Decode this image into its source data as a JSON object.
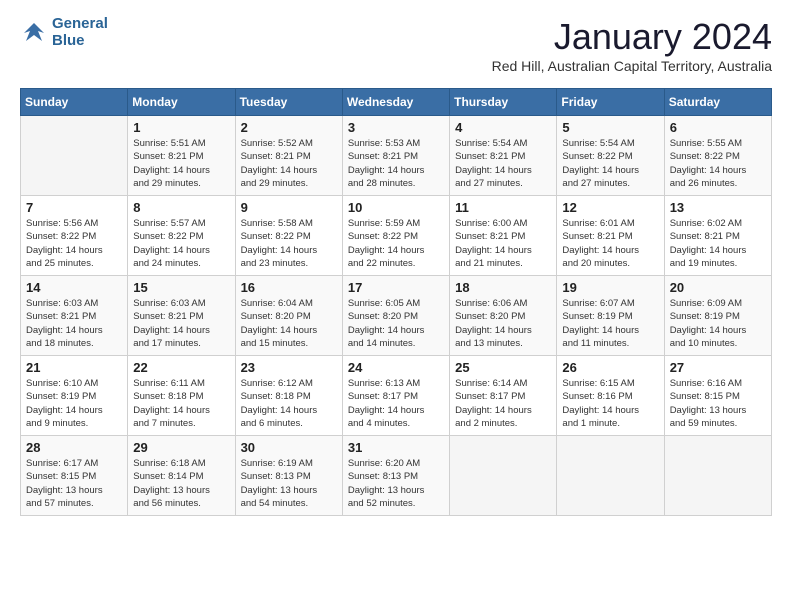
{
  "header": {
    "logo_line1": "General",
    "logo_line2": "Blue",
    "month": "January 2024",
    "subtitle": "Red Hill, Australian Capital Territory, Australia"
  },
  "weekdays": [
    "Sunday",
    "Monday",
    "Tuesday",
    "Wednesday",
    "Thursday",
    "Friday",
    "Saturday"
  ],
  "weeks": [
    [
      {
        "day": "",
        "info": ""
      },
      {
        "day": "1",
        "info": "Sunrise: 5:51 AM\nSunset: 8:21 PM\nDaylight: 14 hours\nand 29 minutes."
      },
      {
        "day": "2",
        "info": "Sunrise: 5:52 AM\nSunset: 8:21 PM\nDaylight: 14 hours\nand 29 minutes."
      },
      {
        "day": "3",
        "info": "Sunrise: 5:53 AM\nSunset: 8:21 PM\nDaylight: 14 hours\nand 28 minutes."
      },
      {
        "day": "4",
        "info": "Sunrise: 5:54 AM\nSunset: 8:21 PM\nDaylight: 14 hours\nand 27 minutes."
      },
      {
        "day": "5",
        "info": "Sunrise: 5:54 AM\nSunset: 8:22 PM\nDaylight: 14 hours\nand 27 minutes."
      },
      {
        "day": "6",
        "info": "Sunrise: 5:55 AM\nSunset: 8:22 PM\nDaylight: 14 hours\nand 26 minutes."
      }
    ],
    [
      {
        "day": "7",
        "info": "Sunrise: 5:56 AM\nSunset: 8:22 PM\nDaylight: 14 hours\nand 25 minutes."
      },
      {
        "day": "8",
        "info": "Sunrise: 5:57 AM\nSunset: 8:22 PM\nDaylight: 14 hours\nand 24 minutes."
      },
      {
        "day": "9",
        "info": "Sunrise: 5:58 AM\nSunset: 8:22 PM\nDaylight: 14 hours\nand 23 minutes."
      },
      {
        "day": "10",
        "info": "Sunrise: 5:59 AM\nSunset: 8:22 PM\nDaylight: 14 hours\nand 22 minutes."
      },
      {
        "day": "11",
        "info": "Sunrise: 6:00 AM\nSunset: 8:21 PM\nDaylight: 14 hours\nand 21 minutes."
      },
      {
        "day": "12",
        "info": "Sunrise: 6:01 AM\nSunset: 8:21 PM\nDaylight: 14 hours\nand 20 minutes."
      },
      {
        "day": "13",
        "info": "Sunrise: 6:02 AM\nSunset: 8:21 PM\nDaylight: 14 hours\nand 19 minutes."
      }
    ],
    [
      {
        "day": "14",
        "info": "Sunrise: 6:03 AM\nSunset: 8:21 PM\nDaylight: 14 hours\nand 18 minutes."
      },
      {
        "day": "15",
        "info": "Sunrise: 6:03 AM\nSunset: 8:21 PM\nDaylight: 14 hours\nand 17 minutes."
      },
      {
        "day": "16",
        "info": "Sunrise: 6:04 AM\nSunset: 8:20 PM\nDaylight: 14 hours\nand 15 minutes."
      },
      {
        "day": "17",
        "info": "Sunrise: 6:05 AM\nSunset: 8:20 PM\nDaylight: 14 hours\nand 14 minutes."
      },
      {
        "day": "18",
        "info": "Sunrise: 6:06 AM\nSunset: 8:20 PM\nDaylight: 14 hours\nand 13 minutes."
      },
      {
        "day": "19",
        "info": "Sunrise: 6:07 AM\nSunset: 8:19 PM\nDaylight: 14 hours\nand 11 minutes."
      },
      {
        "day": "20",
        "info": "Sunrise: 6:09 AM\nSunset: 8:19 PM\nDaylight: 14 hours\nand 10 minutes."
      }
    ],
    [
      {
        "day": "21",
        "info": "Sunrise: 6:10 AM\nSunset: 8:19 PM\nDaylight: 14 hours\nand 9 minutes."
      },
      {
        "day": "22",
        "info": "Sunrise: 6:11 AM\nSunset: 8:18 PM\nDaylight: 14 hours\nand 7 minutes."
      },
      {
        "day": "23",
        "info": "Sunrise: 6:12 AM\nSunset: 8:18 PM\nDaylight: 14 hours\nand 6 minutes."
      },
      {
        "day": "24",
        "info": "Sunrise: 6:13 AM\nSunset: 8:17 PM\nDaylight: 14 hours\nand 4 minutes."
      },
      {
        "day": "25",
        "info": "Sunrise: 6:14 AM\nSunset: 8:17 PM\nDaylight: 14 hours\nand 2 minutes."
      },
      {
        "day": "26",
        "info": "Sunrise: 6:15 AM\nSunset: 8:16 PM\nDaylight: 14 hours\nand 1 minute."
      },
      {
        "day": "27",
        "info": "Sunrise: 6:16 AM\nSunset: 8:15 PM\nDaylight: 13 hours\nand 59 minutes."
      }
    ],
    [
      {
        "day": "28",
        "info": "Sunrise: 6:17 AM\nSunset: 8:15 PM\nDaylight: 13 hours\nand 57 minutes."
      },
      {
        "day": "29",
        "info": "Sunrise: 6:18 AM\nSunset: 8:14 PM\nDaylight: 13 hours\nand 56 minutes."
      },
      {
        "day": "30",
        "info": "Sunrise: 6:19 AM\nSunset: 8:13 PM\nDaylight: 13 hours\nand 54 minutes."
      },
      {
        "day": "31",
        "info": "Sunrise: 6:20 AM\nSunset: 8:13 PM\nDaylight: 13 hours\nand 52 minutes."
      },
      {
        "day": "",
        "info": ""
      },
      {
        "day": "",
        "info": ""
      },
      {
        "day": "",
        "info": ""
      }
    ]
  ]
}
